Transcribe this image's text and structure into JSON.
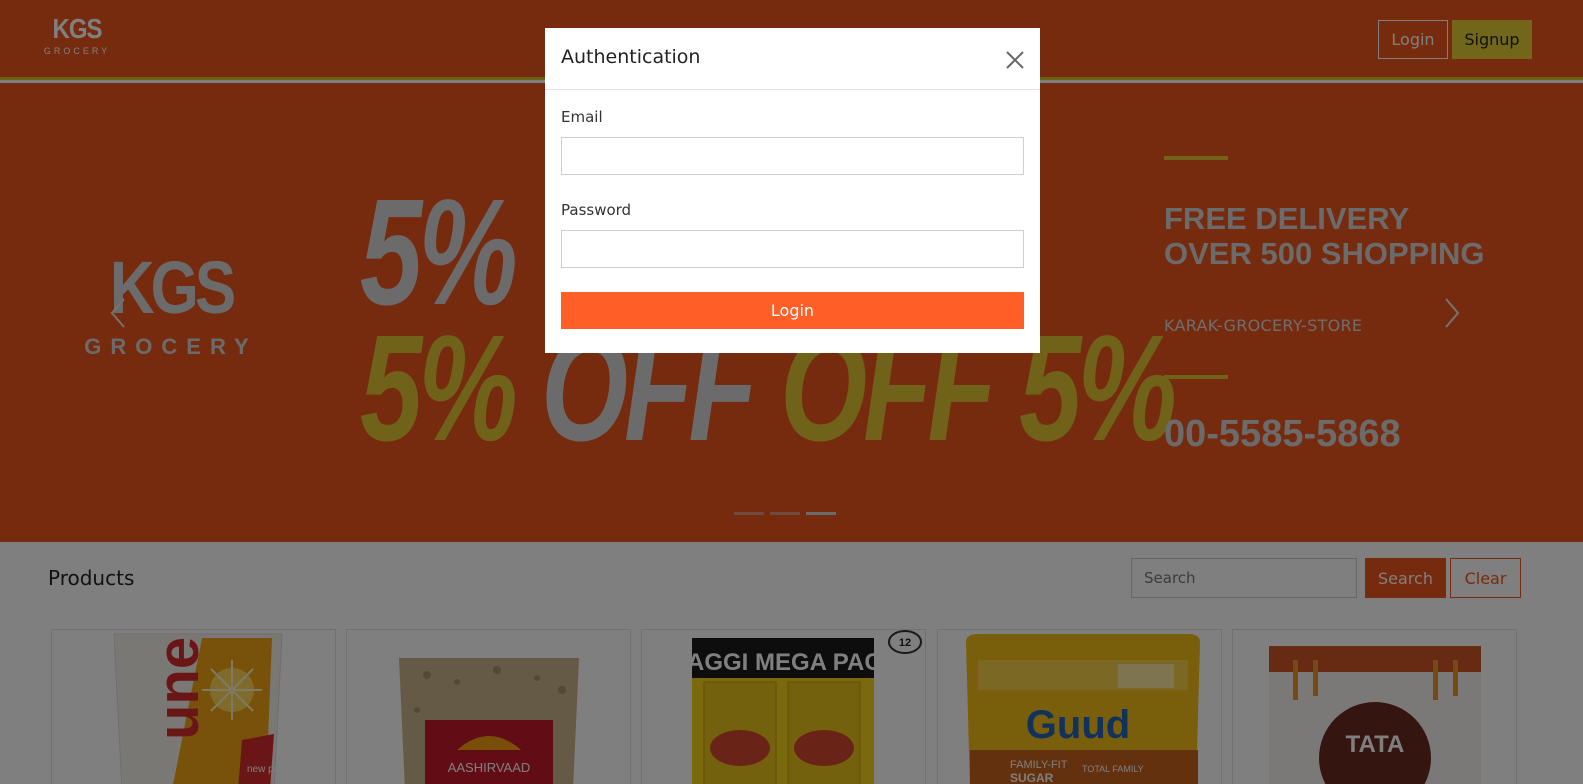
{
  "header": {
    "logo_line1": "KGS",
    "logo_line2": "GROCERY",
    "login_label": "Login",
    "signup_label": "Signup"
  },
  "carousel": {
    "logo_line1": "KGS",
    "logo_line2": "GROCERY",
    "promo_top": "5%",
    "promo_bottom_part1": "5%",
    "promo_bottom_part2": " OFF",
    "promo_bottom_part3": " OFF 5%",
    "delivery_text": "FREE DELIVERY OVER 500 SHOPPING",
    "store_name": "KARAK-GROCERY-STORE",
    "phone": "00-5585-5868",
    "slide_count": 3,
    "active_slide": 3
  },
  "products": {
    "title": "Products",
    "search_placeholder": "Search",
    "search_label": "Search",
    "clear_label": "Clear",
    "items": [
      {
        "icon": "fortune-oil-pack-image",
        "label_fragment": "une",
        "badge": "new pack"
      },
      {
        "icon": "aashirvaad-atta-bag-image",
        "label_fragment": "AASHIRVAAD"
      },
      {
        "icon": "maggi-mega-pack-image",
        "label_fragment": "MAGGI MEGA PACK",
        "badge": "12"
      },
      {
        "icon": "guud-sugar-jar-image",
        "label_fragment": "Guud",
        "sub1": "FAMILY-FIT",
        "sub2": "SUGAR",
        "sub3": "TOTAL FAMILY"
      },
      {
        "icon": "tata-sampann-pack-image",
        "label_fragment": "TATA"
      }
    ]
  },
  "modal": {
    "title": "Authentication",
    "email_label": "Email",
    "email_value": "",
    "password_label": "Password",
    "password_value": "",
    "login_label": "Login"
  },
  "colors": {
    "brand_orange": "#ef561d",
    "accent_yellow": "#e2c433",
    "modal_button": "#ff5e26"
  }
}
